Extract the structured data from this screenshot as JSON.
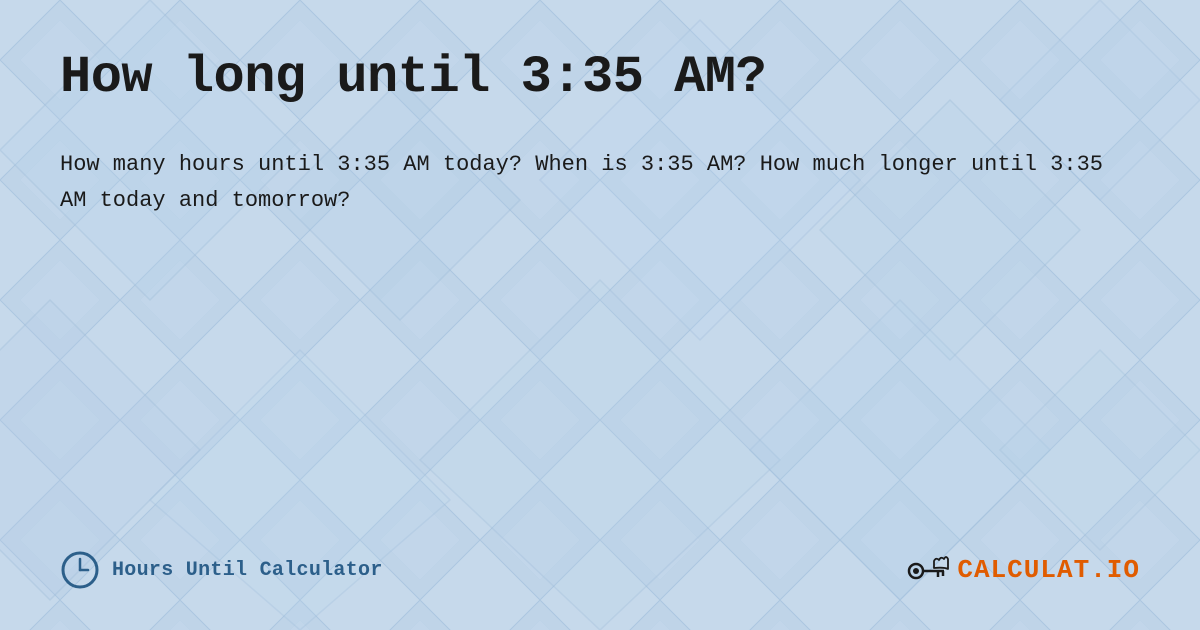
{
  "page": {
    "title": "How long until 3:35 AM?",
    "description": "How many hours until 3:35 AM today? When is 3:35 AM? How much longer until 3:35 AM today and tomorrow?",
    "background_color": "#c8d8ed"
  },
  "footer": {
    "left_brand": "Hours Until Calculator",
    "right_brand_part1": "CALCULAT",
    "right_brand_part2": ".IO"
  }
}
